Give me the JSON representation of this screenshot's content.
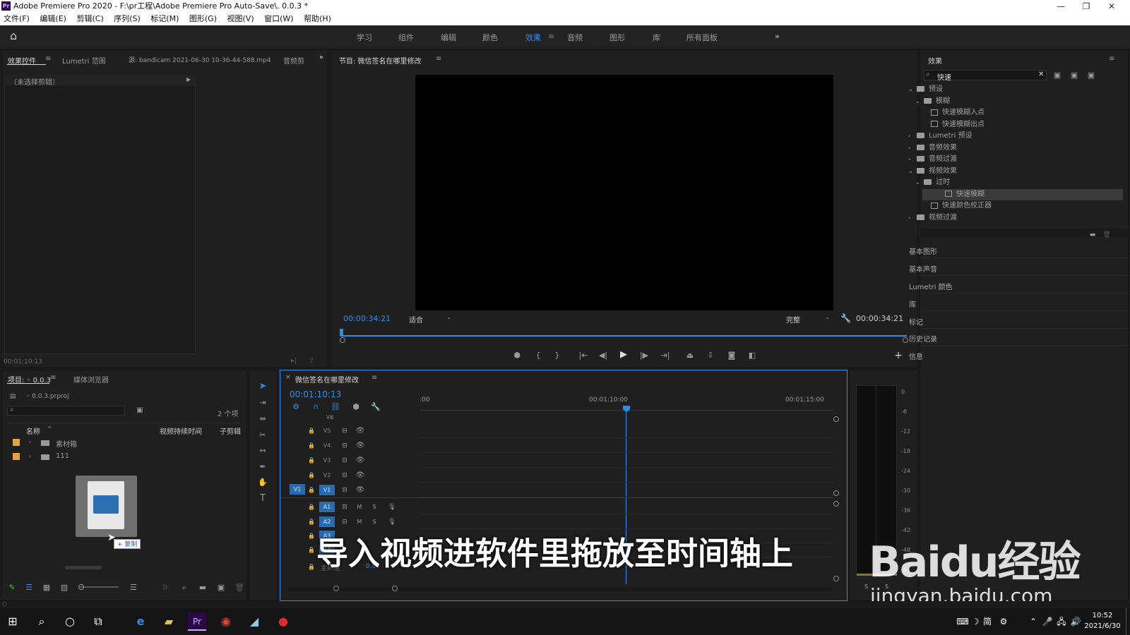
{
  "app": {
    "title": "Adobe Premiere Pro 2020 - F:\\pr工程\\Adobe Premiere Pro Auto-Save\\. 0.0.3 *",
    "logo": "Pr"
  },
  "menu": [
    "文件(F)",
    "编辑(E)",
    "剪辑(C)",
    "序列(S)",
    "标记(M)",
    "图形(G)",
    "视图(V)",
    "窗口(W)",
    "帮助(H)"
  ],
  "workspaces": {
    "items": [
      "学习",
      "组件",
      "编辑",
      "颜色",
      "效果",
      "音频",
      "图形",
      "库",
      "所有面板"
    ],
    "active_index": 4,
    "more": "»"
  },
  "source_panel": {
    "tabs": [
      "效果控件",
      "Lumetri 范围",
      "源: bandicam 2021-06-30 10-36-44-588.mp4",
      "音频剪"
    ],
    "no_clip": "（未选择剪辑）",
    "timecode": "00:01:10:13"
  },
  "program_panel": {
    "title": "节目: 微信签名在哪里修改",
    "timecode_left": "00:00:34:21",
    "fit_label": "适合",
    "quality_label": "完整",
    "timecode_right": "00:00:34:21",
    "playhead_fraction": 0.001
  },
  "effects_panel": {
    "title": "效果",
    "search_value": "快速",
    "tree": [
      {
        "label": "预设",
        "level": 0,
        "type": "folder",
        "expanded": true
      },
      {
        "label": "模糊",
        "level": 1,
        "type": "folder",
        "expanded": true
      },
      {
        "label": "快速模糊入点",
        "level": 2,
        "type": "effect"
      },
      {
        "label": "快速模糊出点",
        "level": 2,
        "type": "effect"
      },
      {
        "label": "Lumetri 预设",
        "level": 0,
        "type": "folder",
        "expanded": false
      },
      {
        "label": "音频效果",
        "level": 0,
        "type": "folder",
        "expanded": false
      },
      {
        "label": "音频过渡",
        "level": 0,
        "type": "folder",
        "expanded": false
      },
      {
        "label": "视频效果",
        "level": 0,
        "type": "folder",
        "expanded": true
      },
      {
        "label": "过时",
        "level": 1,
        "type": "folder",
        "expanded": true
      },
      {
        "label": "快速模糊",
        "level": 2,
        "type": "effect",
        "selected": true
      },
      {
        "label": "快速颜色校正器",
        "level": 2,
        "type": "effect"
      },
      {
        "label": "视频过渡",
        "level": 0,
        "type": "folder",
        "expanded": false
      }
    ],
    "side_panels": [
      "基本图形",
      "基本声音",
      "Lumetri 颜色",
      "库",
      "标记",
      "历史记录",
      "信息"
    ]
  },
  "project_panel": {
    "tabs": [
      "项目: ◦ 0.0.3",
      "媒体浏览器"
    ],
    "file": "◦ 0.0.3.prproj",
    "item_count": "2 个项",
    "columns": [
      "名称",
      "视频持续时间",
      "子剪辑"
    ],
    "items": [
      {
        "name": "素材箱",
        "color": "#e8a33c"
      },
      {
        "name": "111",
        "color": "#e8a33c"
      }
    ],
    "drag_tooltip": "+ 复制"
  },
  "timeline": {
    "title": "微信签名在哪里修改",
    "timecode": "00:01:10:13",
    "ruler_labels": [
      ":00",
      "00:01:10:00",
      "00:01:15:00"
    ],
    "video_tracks": [
      "V6",
      "V5",
      "V4",
      "V3",
      "V2",
      "V1"
    ],
    "audio_tracks": [
      "A1",
      "A2",
      "A3",
      "A4"
    ],
    "master_label": "主声道",
    "master_value": "0.0",
    "source_patch": "V1"
  },
  "meter": {
    "labels": [
      "0",
      "-6",
      "-12",
      "-18",
      "-24",
      "-30",
      "-36",
      "-42",
      "-48",
      "-54"
    ],
    "solo_labels": [
      "S",
      "S"
    ]
  },
  "caption": "导入视频进软件里拖放至时间轴上",
  "watermark": {
    "brand": "Baidu经验",
    "url": "jingyan.baidu.com"
  },
  "taskbar": {
    "time": "10:52",
    "date": "2021/6/30",
    "ime": "简"
  },
  "colors": {
    "accent": "#2d8ceb",
    "panel_bg": "#1f1f1f",
    "app_bg": "#1d1d1d"
  }
}
